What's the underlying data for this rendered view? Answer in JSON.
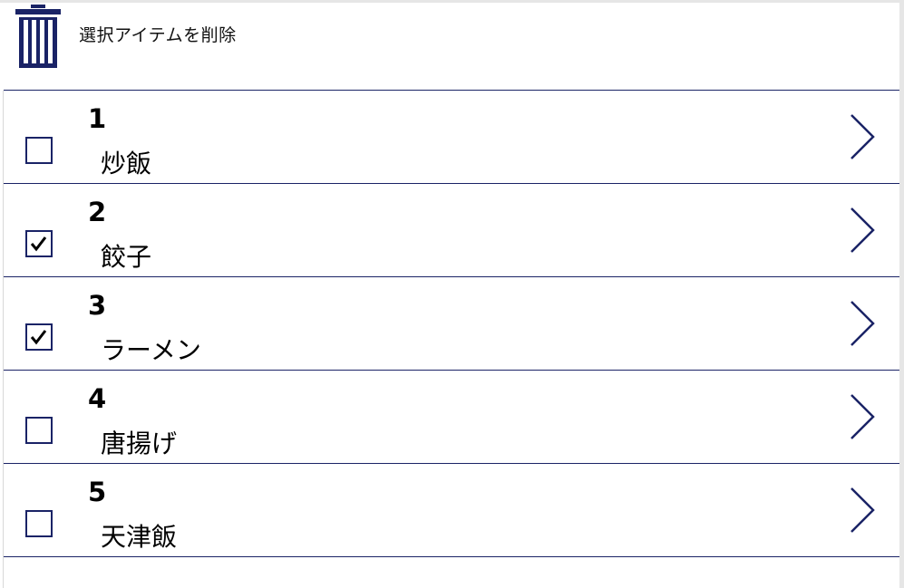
{
  "toolbar": {
    "delete_label": "選択アイテムを削除",
    "icon": "trash-icon"
  },
  "colors": {
    "accent": "#1a2366",
    "text": "#000000"
  },
  "items": [
    {
      "id": "1",
      "name": "炒飯",
      "checked": false
    },
    {
      "id": "2",
      "name": "餃子",
      "checked": true
    },
    {
      "id": "3",
      "name": "ラーメン",
      "checked": true
    },
    {
      "id": "4",
      "name": "唐揚げ",
      "checked": false
    },
    {
      "id": "5",
      "name": "天津飯",
      "checked": false
    }
  ]
}
